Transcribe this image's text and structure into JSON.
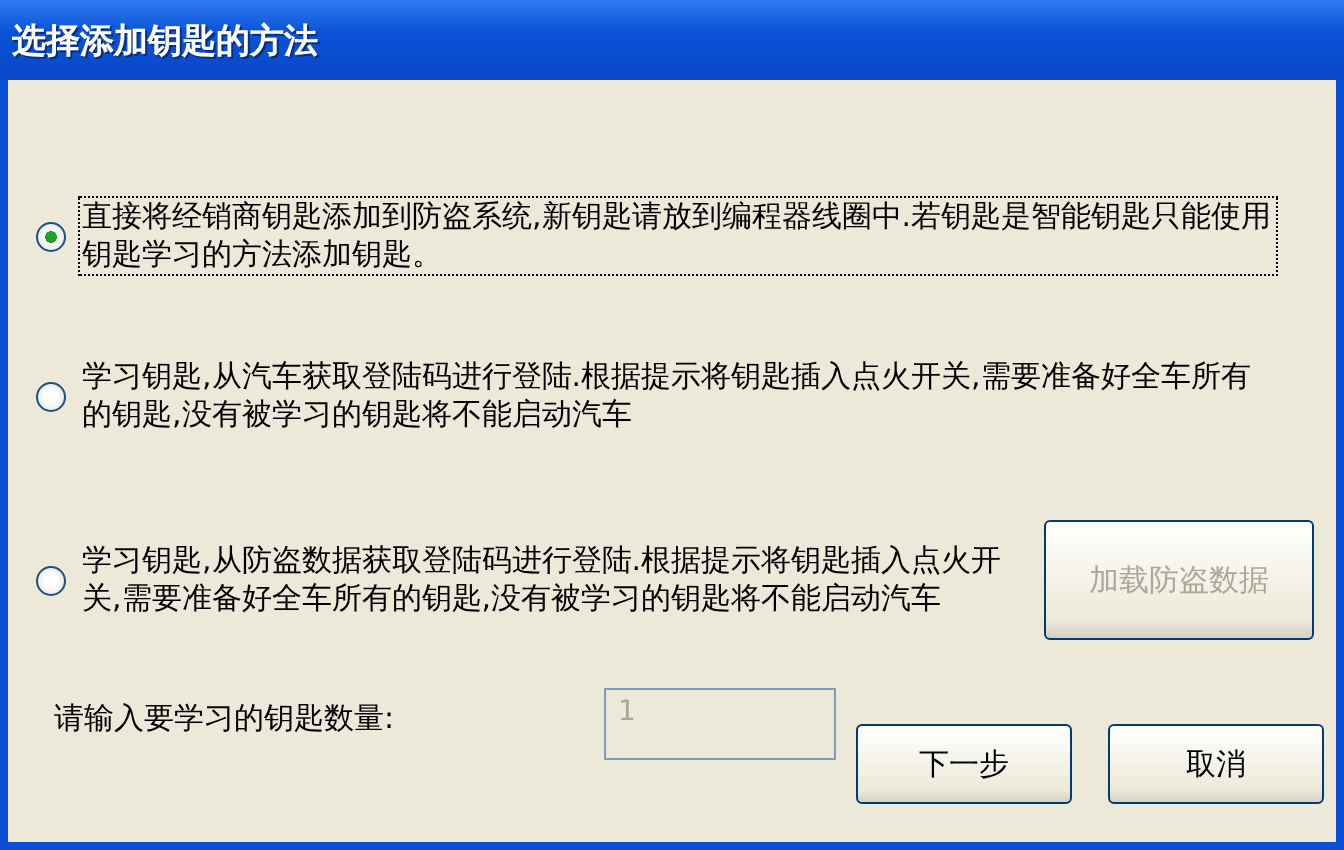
{
  "window": {
    "title": "选择添加钥匙的方法"
  },
  "options": [
    {
      "label": "直接将经销商钥匙添加到防盗系统,新钥匙请放到编程器线圈中.若钥匙是智能钥匙只能使用钥匙学习的方法添加钥匙。",
      "selected": true
    },
    {
      "label": "学习钥匙,从汽车获取登陆码进行登陆.根据提示将钥匙插入点火开关,需要准备好全车所有的钥匙,没有被学习的钥匙将不能启动汽车",
      "selected": false
    },
    {
      "label": "学习钥匙,从防盗数据获取登陆码进行登陆.根据提示将钥匙插入点火开关,需要准备好全车所有的钥匙,没有被学习的钥匙将不能启动汽车",
      "selected": false
    }
  ],
  "load_button": {
    "label": "加载防盗数据",
    "disabled": true
  },
  "key_count": {
    "label": "请输入要学习的钥匙数量:",
    "value": "1",
    "disabled": true
  },
  "buttons": [
    {
      "label": "下一步"
    },
    {
      "label": "取消"
    }
  ]
}
